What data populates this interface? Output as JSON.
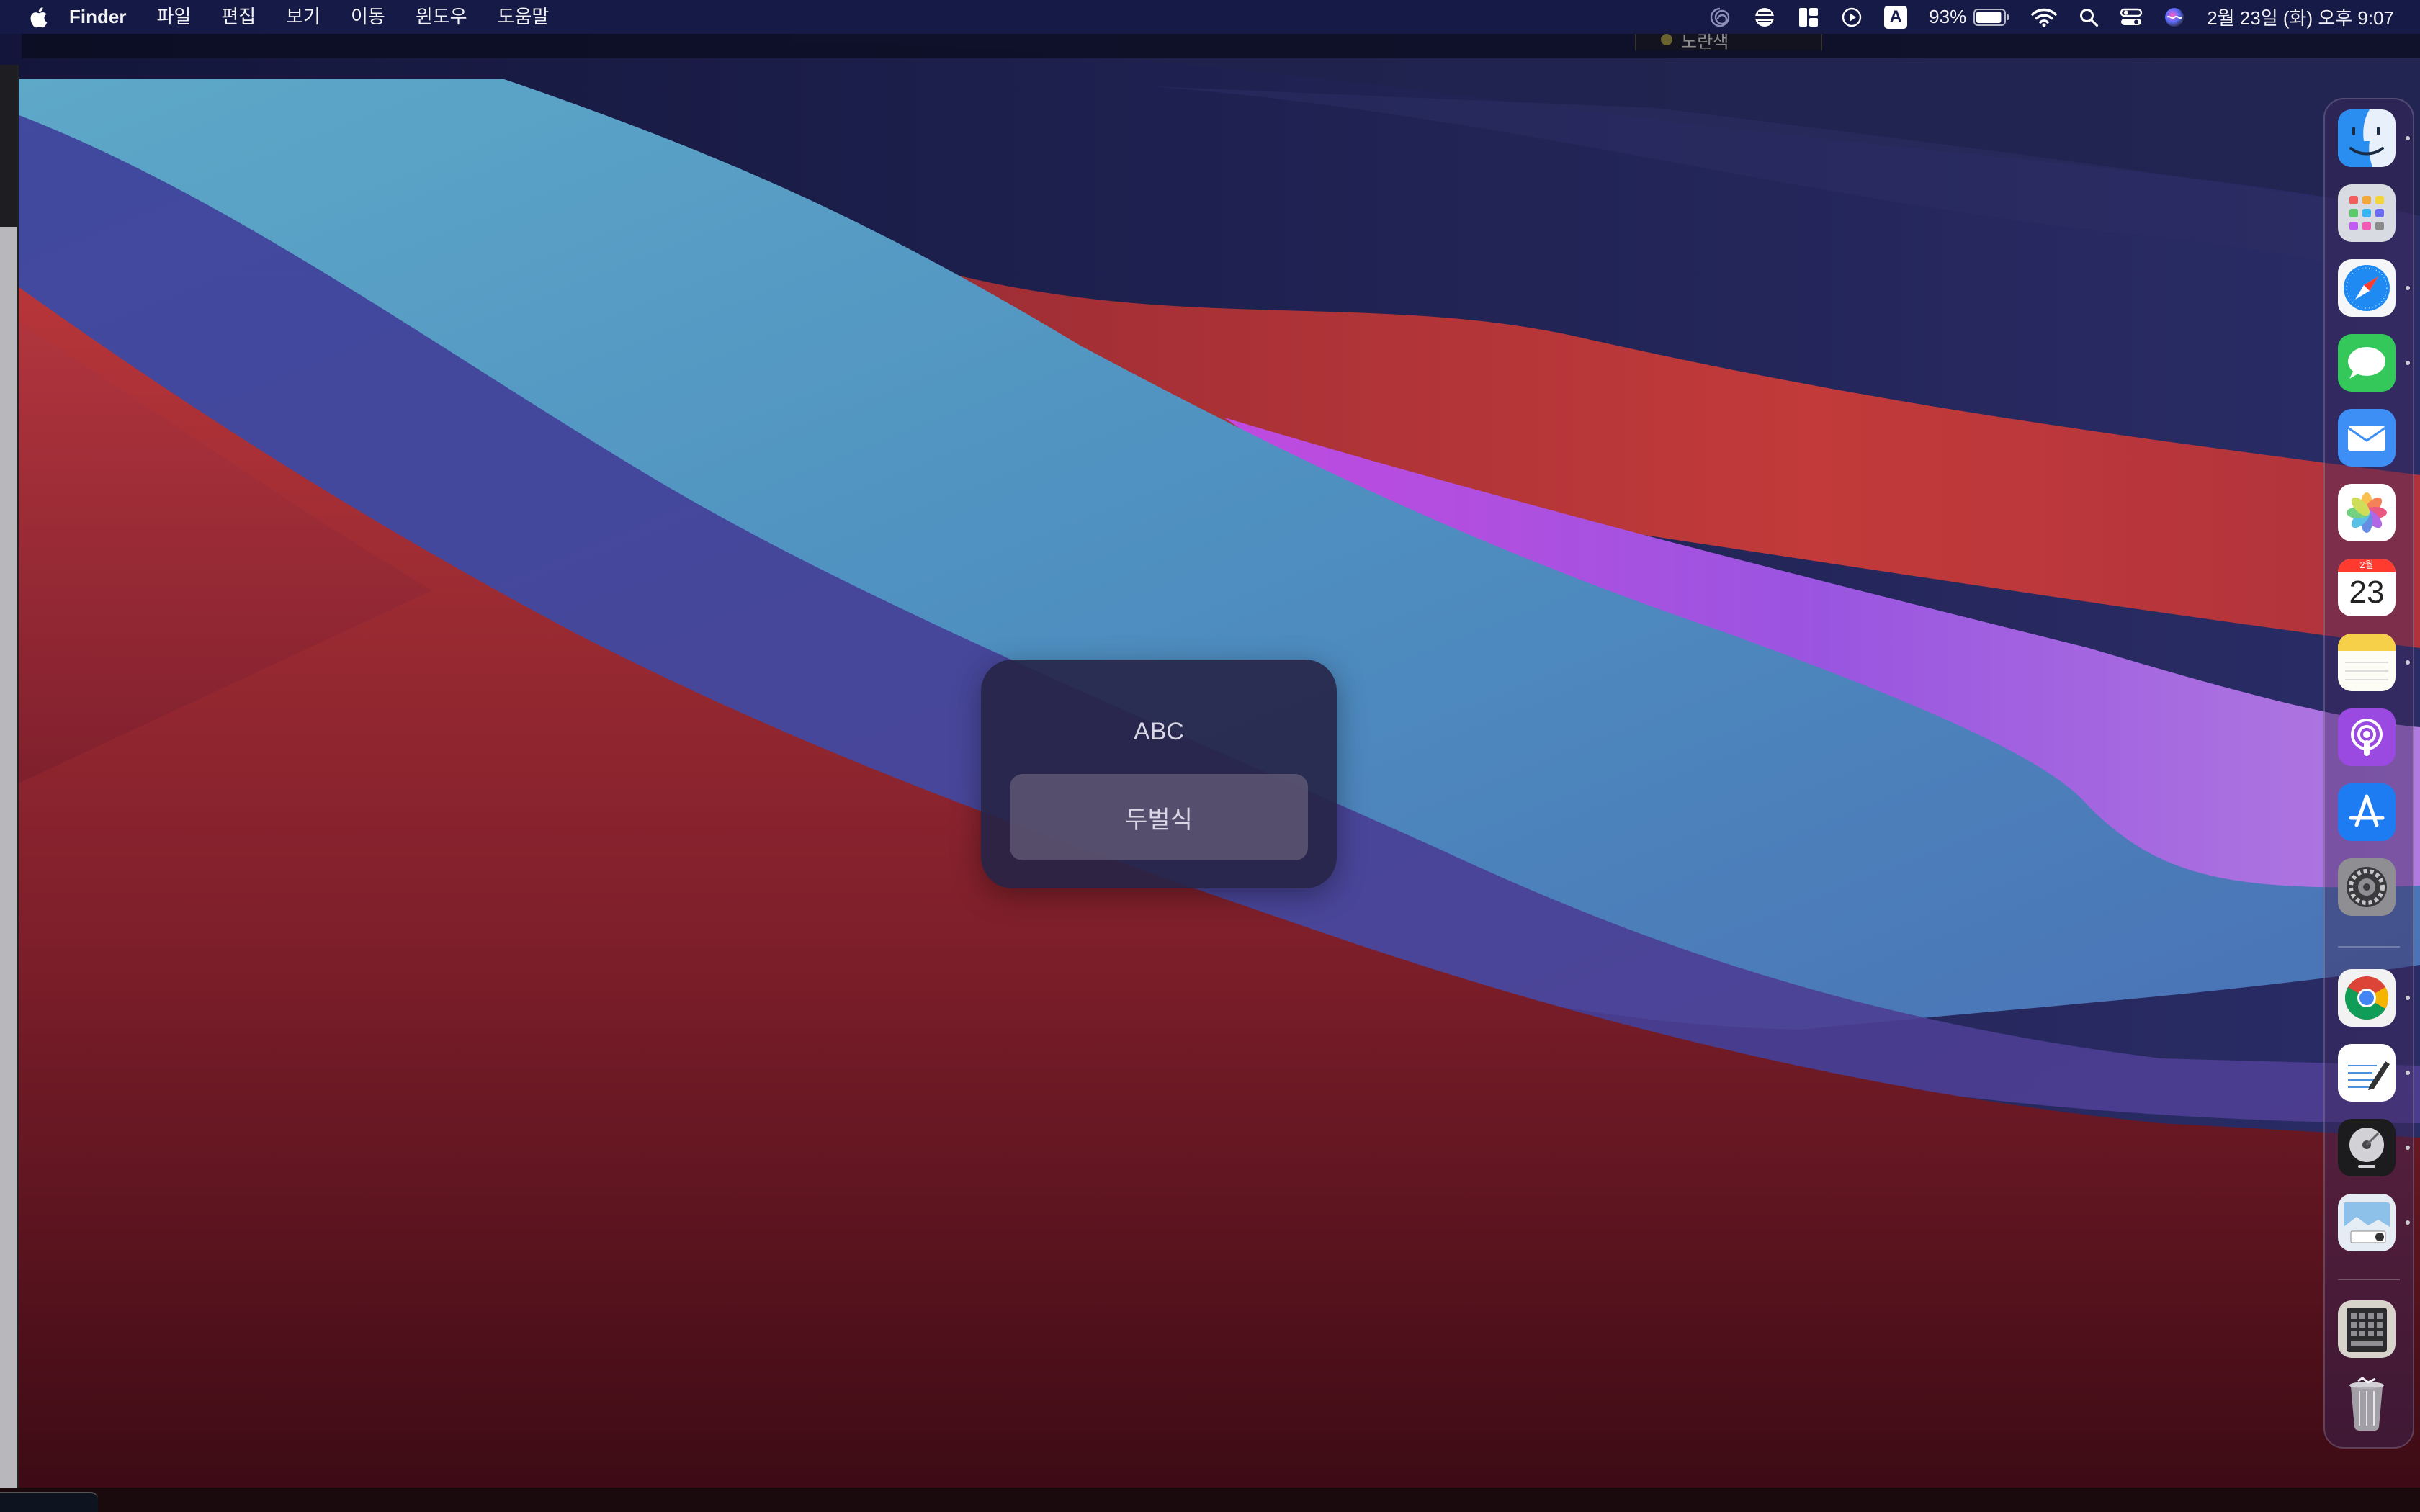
{
  "menubar": {
    "apple_icon": "apple-icon",
    "app_name": "Finder",
    "menus": [
      "파일",
      "편집",
      "보기",
      "이동",
      "윈도우",
      "도움말"
    ],
    "battery_percent": "93%",
    "battery_level": 0.93,
    "input_indicator": "A",
    "datetime": "2월 23일 (화) 오후 9:07"
  },
  "background_window": {
    "tag_label": "노란색",
    "tag_color": "#6a6330"
  },
  "input_switcher": {
    "options": [
      "ABC",
      "두벌식"
    ],
    "selected": "두벌식"
  },
  "dock": {
    "calendar_month": "2월",
    "calendar_day": "23",
    "apps": [
      "Finder",
      "Launchpad",
      "Safari",
      "Messages",
      "Mail",
      "Photos",
      "Calendar",
      "Notes",
      "Podcasts",
      "App Store",
      "System Preferences",
      "Chrome",
      "TextEdit",
      "Disk Utility",
      "Preview",
      "Keyboard Viewer",
      "Trash"
    ]
  },
  "colors": {
    "menubar": "#161a46",
    "wallpaper_blue": "#5aa0c4",
    "wallpaper_red": "#b8353a",
    "wallpaper_purple": "#9d4fe0",
    "wallpaper_navy": "#1a1c48"
  }
}
